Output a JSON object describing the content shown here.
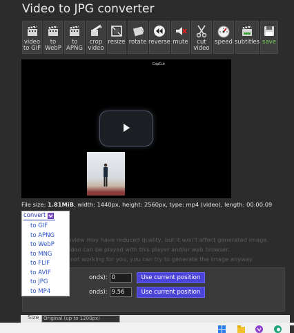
{
  "page": {
    "title": "Video to JPG converter"
  },
  "toolbar": [
    {
      "name": "to-gif",
      "label": "video to GIF",
      "icon": "clapperboard-icon"
    },
    {
      "name": "to-webp",
      "label": "to WebP",
      "icon": "clapperboard-icon"
    },
    {
      "name": "to-apng",
      "label": "to APNG",
      "icon": "clapperboard-icon"
    },
    {
      "name": "crop",
      "label": "crop video",
      "icon": "crop-icon"
    },
    {
      "name": "resize",
      "label": "resize",
      "icon": "resize-icon"
    },
    {
      "name": "rotate",
      "label": "rotate",
      "icon": "rotate-icon"
    },
    {
      "name": "reverse",
      "label": "reverse",
      "icon": "rewind-icon"
    },
    {
      "name": "mute",
      "label": "mute",
      "icon": "mute-icon"
    },
    {
      "name": "cut",
      "label": "cut video",
      "icon": "scissors-icon"
    },
    {
      "name": "speed",
      "label": "speed",
      "icon": "speedometer-icon"
    },
    {
      "name": "subtitles",
      "label": "subtitles",
      "icon": "subtitles-icon"
    },
    {
      "name": "save",
      "label": "save",
      "icon": "floppy-disk-icon"
    }
  ],
  "video": {
    "brand": "CapCut"
  },
  "fileinfo": {
    "prefix": "File size: ",
    "size": "1.81MiB",
    "rest": ", width: 1440px, height: 2560px, type: mp4 (video), length: 00:00:09"
  },
  "notes": [
    "review may have reduced quality, but it won't affect generated image.",
    "video can be played with this player and/or web browser.",
    "s not working for you, you can try to generate the image anyway."
  ],
  "dropdown": {
    "label": "convert",
    "items": [
      "to GIF",
      "to APNG",
      "to WebP",
      "to MNG",
      "to FLIF",
      "to AVIF",
      "to JPG",
      "to MP4"
    ]
  },
  "position": {
    "row1_label": "onds):",
    "row1_value": "0",
    "row2_label": "onds):",
    "row2_value": "9.56",
    "button_label": "Use current position"
  },
  "size_row": {
    "label": "Size",
    "select_value": "Original (up to 1200px)"
  },
  "colors": {
    "background": "#2c2c2c",
    "accent_button": "#4b44d8",
    "link": "#2952c8",
    "save_green": "#7ad15c"
  }
}
